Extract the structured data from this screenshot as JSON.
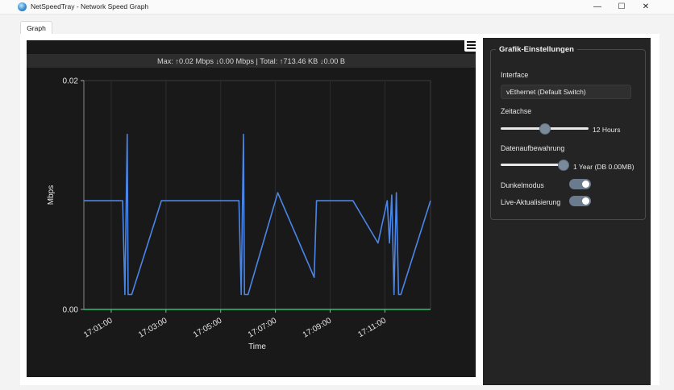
{
  "window": {
    "title": "NetSpeedTray - Network Speed Graph",
    "icon": "globe-icon",
    "controls": {
      "minimize": "—",
      "maximize": "☐",
      "close": "✕"
    }
  },
  "tabs": [
    {
      "label": "Graph",
      "active": true
    }
  ],
  "graph": {
    "stats": "Max: ↑0.02 Mbps ↓0.00 Mbps | Total: ↑713.46 KB ↓0.00 B",
    "menu_icon": "hamburger-menu-icon"
  },
  "chart_data": {
    "type": "line",
    "xlabel": "Time",
    "ylabel": "Mbps",
    "ylim": [
      0,
      0.02
    ],
    "y_ticks": [
      "0.00",
      "0.02"
    ],
    "x_ticks": [
      "17:01:00",
      "17:03:00",
      "17:05:00",
      "17:07:00",
      "17:09:00",
      "17:11:00"
    ],
    "x_range": [
      "17:00:00",
      "17:12:40"
    ],
    "grid": true,
    "series": [
      {
        "color": "#4a86e8",
        "points": [
          [
            "17:00:00",
            0.0095
          ],
          [
            "17:01:25",
            0.0095
          ],
          [
            "17:01:30",
            0.0013
          ],
          [
            "17:01:35",
            0.0153
          ],
          [
            "17:01:37",
            0.0013
          ],
          [
            "17:01:45",
            0.0013
          ],
          [
            "17:02:50",
            0.0095
          ],
          [
            "17:05:40",
            0.0095
          ],
          [
            "17:05:45",
            0.0013
          ],
          [
            "17:05:50",
            0.0153
          ],
          [
            "17:05:52",
            0.0013
          ],
          [
            "17:06:00",
            0.0013
          ],
          [
            "17:07:05",
            0.0102
          ],
          [
            "17:08:25",
            0.0028
          ],
          [
            "17:08:30",
            0.0095
          ],
          [
            "17:09:50",
            0.0095
          ],
          [
            "17:10:45",
            0.0058
          ],
          [
            "17:11:05",
            0.0095
          ],
          [
            "17:11:10",
            0.0058
          ],
          [
            "17:11:15",
            0.01
          ],
          [
            "17:11:20",
            0.0013
          ],
          [
            "17:11:25",
            0.0102
          ],
          [
            "17:11:30",
            0.0013
          ],
          [
            "17:11:35",
            0.0013
          ],
          [
            "17:12:40",
            0.0095
          ]
        ]
      },
      {
        "color": "#2fbf71",
        "points": [
          [
            "17:00:00",
            0.0
          ],
          [
            "17:12:40",
            0.0
          ]
        ]
      }
    ]
  },
  "settings": {
    "title": "Grafik-Einstellungen",
    "interface_label": "Interface",
    "interface_value": "vEthernet (Default Switch)",
    "timeline_label": "Zeitachse",
    "timeline_value": "12 Hours",
    "timeline_fraction": 0.5,
    "retention_label": "Datenaufbewahrung",
    "retention_value": "1 Year (DB 0.00MB)",
    "retention_fraction": 1.0,
    "dark_mode_label": "Dunkelmodus",
    "dark_mode_on": true,
    "live_update_label": "Live-Aktualisierung",
    "live_update_on": true,
    "accent_color": "#6b7b8e"
  }
}
